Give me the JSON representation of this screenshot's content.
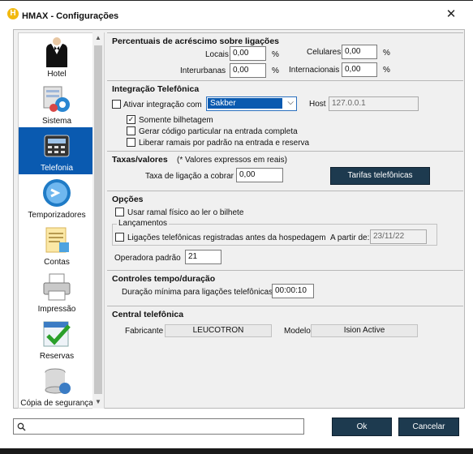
{
  "window": {
    "app": "HMAX",
    "title": "HMAX - Configurações",
    "logo_letter": "H"
  },
  "sidebar": {
    "items": [
      {
        "label": "Hotel",
        "icon": "butler-icon"
      },
      {
        "label": "Sistema",
        "icon": "system-gears-icon"
      },
      {
        "label": "Telefonia",
        "icon": "telephone-icon",
        "active": true
      },
      {
        "label": "Temporizadores",
        "icon": "timer-icon"
      },
      {
        "label": "Contas",
        "icon": "receipt-icon"
      },
      {
        "label": "Impressão",
        "icon": "printer-icon"
      },
      {
        "label": "Reservas",
        "icon": "reservation-check-icon"
      },
      {
        "label": "Cópia de segurança",
        "icon": "database-backup-icon"
      }
    ]
  },
  "percentuais": {
    "title": "Percentuais de acréscimo sobre ligações",
    "locais_label": "Locais",
    "locais_value": "0,00",
    "celulares_label": "Celulares",
    "celulares_value": "0,00",
    "interurbanas_label": "Interurbanas",
    "interurbanas_value": "0,00",
    "internacionais_label": "Internacionais",
    "internacionais_value": "0,00",
    "percent": "%"
  },
  "integracao": {
    "title": "Integração Telefônica",
    "ativar_label": "Ativar integração com",
    "ativar_checked": false,
    "system_value": "Sakber",
    "host_label": "Host",
    "host_value": "127.0.0.1",
    "somente_label": "Somente bilhetagem",
    "somente_checked": true,
    "gerar_label": "Gerar código particular na entrada completa",
    "gerar_checked": false,
    "liberar_label": "Liberar ramais por padrão na entrada e reserva",
    "liberar_checked": false
  },
  "taxas": {
    "title": "Taxas/valores",
    "note": "(* Valores expressos em reais)",
    "taxa_label": "Taxa de ligação a cobrar",
    "taxa_value": "0,00",
    "tarifas_button": "Tarifas telefônicas"
  },
  "opcoes": {
    "title": "Opções",
    "usar_label": "Usar ramal físico ao ler o bilhete",
    "usar_checked": false,
    "lancamentos_label": "Lançamentos",
    "ligacoes_label": "Ligações telefônicas registradas antes da hospedagem",
    "ligacoes_checked": false,
    "apartir_label": "A partir de:",
    "apartir_value": "23/11/22",
    "operadora_label": "Operadora padrão",
    "operadora_value": "21"
  },
  "controles": {
    "title": "Controles tempo/duração",
    "duracao_label": "Duração mínima para ligações telefônicas",
    "duracao_value": "00:00:10"
  },
  "central": {
    "title": "Central telefônica",
    "fabricante_label": "Fabricante",
    "fabricante_value": "LEUCOTRON",
    "modelo_label": "Modelo",
    "modelo_value": "Ision Active"
  },
  "footer": {
    "search_value": "",
    "ok_label": "Ok",
    "cancel_label": "Cancelar"
  },
  "colors": {
    "active_blue": "#0a5ab0",
    "dark_button": "#1d3a4f",
    "logo_yellow": "#f2b90f"
  }
}
